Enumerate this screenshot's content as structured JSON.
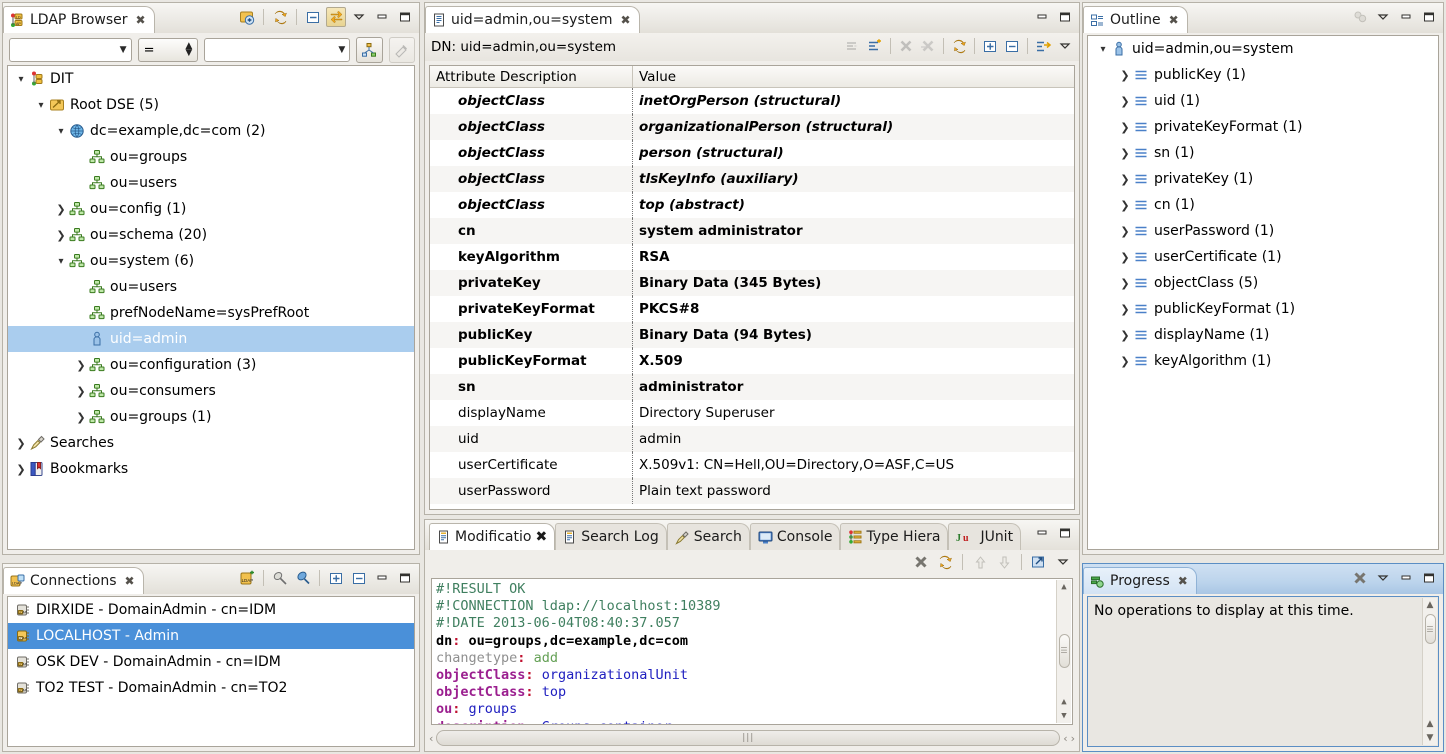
{
  "ldap_browser": {
    "tab_label": "LDAP Browser",
    "tab_close": "✖",
    "toolbar": [
      {
        "name": "open-connection-icon",
        "tip": "Open Connection"
      },
      {
        "name": "refresh-icon",
        "tip": "Refresh"
      },
      {
        "name": "collapse-all-icon",
        "tip": "Collapse All"
      },
      {
        "name": "link-with-editor-icon",
        "tip": "Link with Editor",
        "pressed": true
      },
      {
        "name": "view-menu-icon",
        "tip": "View Menu"
      },
      {
        "name": "minimize-icon",
        "tip": "Minimize"
      },
      {
        "name": "maximize-icon",
        "tip": "Maximize"
      }
    ],
    "filter": {
      "attribute_value": "",
      "attribute_placeholder": "",
      "operator_value": "=",
      "value_value": "",
      "value_placeholder": "",
      "quick_filter_button": "quick-filter-icon",
      "clear_filter_button": "clear-filter-icon"
    },
    "tree": [
      {
        "label": "DIT",
        "indent": 0,
        "twist": "open",
        "icon": "dit-icon",
        "selected": false
      },
      {
        "label": "Root DSE (5)",
        "indent": 1,
        "twist": "open",
        "icon": "rootdse-icon",
        "selected": false
      },
      {
        "label": "dc=example,dc=com (2)",
        "indent": 2,
        "twist": "open",
        "icon": "domain-icon",
        "selected": false
      },
      {
        "label": "ou=groups",
        "indent": 3,
        "twist": "none",
        "icon": "ou-icon",
        "selected": false
      },
      {
        "label": "ou=users",
        "indent": 3,
        "twist": "none",
        "icon": "ou-icon",
        "selected": false
      },
      {
        "label": "ou=config (1)",
        "indent": 2,
        "twist": "closed",
        "icon": "ou-icon",
        "selected": false
      },
      {
        "label": "ou=schema (20)",
        "indent": 2,
        "twist": "closed",
        "icon": "ou-icon",
        "selected": false
      },
      {
        "label": "ou=system (6)",
        "indent": 2,
        "twist": "open",
        "icon": "ou-icon",
        "selected": false
      },
      {
        "label": "ou=users",
        "indent": 3,
        "twist": "none",
        "icon": "ou-icon",
        "selected": false
      },
      {
        "label": "prefNodeName=sysPrefRoot",
        "indent": 3,
        "twist": "none",
        "icon": "ou-icon",
        "selected": false
      },
      {
        "label": "uid=admin",
        "indent": 3,
        "twist": "none",
        "icon": "person-icon",
        "selected": true
      },
      {
        "label": "ou=configuration (3)",
        "indent": 3,
        "twist": "closed",
        "icon": "ou-icon",
        "selected": false
      },
      {
        "label": "ou=consumers",
        "indent": 3,
        "twist": "closed",
        "icon": "ou-icon",
        "selected": false
      },
      {
        "label": "ou=groups (1)",
        "indent": 3,
        "twist": "closed",
        "icon": "ou-icon",
        "selected": false
      },
      {
        "label": "Searches",
        "indent": 0,
        "twist": "closed",
        "icon": "searches-icon",
        "selected": false
      },
      {
        "label": "Bookmarks",
        "indent": 0,
        "twist": "closed",
        "icon": "bookmarks-icon",
        "selected": false
      }
    ]
  },
  "connections": {
    "tab_label": "Connections",
    "tab_close": "✖",
    "toolbar": [
      {
        "name": "new-connection-icon"
      },
      {
        "name": "disconnect-icon"
      },
      {
        "name": "connect-icon"
      },
      {
        "name": "expand-all-icon"
      },
      {
        "name": "collapse-all-icon"
      },
      {
        "name": "minimize-icon"
      },
      {
        "name": "maximize-icon"
      }
    ],
    "items": [
      {
        "label": "DIRXIDE - DomainAdmin - cn=IDM",
        "selected": false
      },
      {
        "label": "LOCALHOST - Admin",
        "selected": true
      },
      {
        "label": "OSK DEV - DomainAdmin - cn=IDM",
        "selected": false
      },
      {
        "label": "TO2 TEST - DomainAdmin - cn=TO2",
        "selected": false
      }
    ]
  },
  "editor": {
    "tab_label": "uid=admin,ou=system",
    "tab_close": "✖",
    "dn_label": "DN: uid=admin,ou=system",
    "toolbar": [
      {
        "name": "new-value-icon",
        "disabled": true
      },
      {
        "name": "new-attribute-icon",
        "disabled": false
      },
      {
        "name": "delete-value-icon",
        "disabled": true
      },
      {
        "name": "delete-attribute-icon",
        "disabled": true
      },
      {
        "name": "refresh-icon",
        "disabled": false
      },
      {
        "name": "expand-all-icon",
        "disabled": false
      },
      {
        "name": "collapse-all-icon",
        "disabled": false
      },
      {
        "name": "sort-icon",
        "disabled": false
      },
      {
        "name": "view-menu-icon",
        "disabled": false
      }
    ],
    "minimize": "minimize-icon",
    "maximize": "maximize-icon",
    "columns": [
      "Attribute Description",
      "Value"
    ],
    "rows": [
      {
        "attr": "objectClass",
        "value": "inetOrgPerson (structural)",
        "style": "bold-italic"
      },
      {
        "attr": "objectClass",
        "value": "organizationalPerson (structural)",
        "style": "bold-italic"
      },
      {
        "attr": "objectClass",
        "value": "person (structural)",
        "style": "bold-italic"
      },
      {
        "attr": "objectClass",
        "value": "tlsKeyInfo (auxiliary)",
        "style": "bold-italic"
      },
      {
        "attr": "objectClass",
        "value": "top (abstract)",
        "style": "bold-italic"
      },
      {
        "attr": "cn",
        "value": "system administrator",
        "style": "bold"
      },
      {
        "attr": "keyAlgorithm",
        "value": "RSA",
        "style": "bold"
      },
      {
        "attr": "privateKey",
        "value": "Binary Data (345 Bytes)",
        "style": "bold"
      },
      {
        "attr": "privateKeyFormat",
        "value": "PKCS#8",
        "style": "bold"
      },
      {
        "attr": "publicKey",
        "value": "Binary Data (94 Bytes)",
        "style": "bold"
      },
      {
        "attr": "publicKeyFormat",
        "value": "X.509",
        "style": "bold"
      },
      {
        "attr": "sn",
        "value": "administrator",
        "style": "bold"
      },
      {
        "attr": "displayName",
        "value": "Directory Superuser",
        "style": "normal"
      },
      {
        "attr": "uid",
        "value": "admin",
        "style": "normal"
      },
      {
        "attr": "userCertificate",
        "value": "X.509v1: CN=Hell,OU=Directory,O=ASF,C=US",
        "style": "normal"
      },
      {
        "attr": "userPassword",
        "value": "Plain text password",
        "style": "normal"
      }
    ]
  },
  "modifications": {
    "tabs": [
      {
        "label": "Modificatio",
        "icon": "modifications-icon",
        "active": true,
        "close": "✖"
      },
      {
        "label": "Search Log",
        "icon": "searchlog-icon",
        "active": false
      },
      {
        "label": "Search",
        "icon": "search-icon",
        "active": false
      },
      {
        "label": "Console",
        "icon": "console-icon",
        "active": false
      },
      {
        "label": "Type Hiera",
        "icon": "type-hierarchy-icon",
        "active": false
      },
      {
        "label": "JUnit",
        "icon": "junit-icon",
        "active": false
      }
    ],
    "minimize": "minimize-icon",
    "maximize": "maximize-icon",
    "toolbar": [
      {
        "name": "clear-icon"
      },
      {
        "name": "refresh-icon"
      },
      {
        "name": "previous-icon"
      },
      {
        "name": "next-icon"
      },
      {
        "name": "export-icon"
      },
      {
        "name": "view-menu-icon"
      }
    ],
    "ldif_lines": [
      {
        "type": "comment",
        "text": "#!RESULT OK"
      },
      {
        "type": "comment",
        "text": "#!CONNECTION ldap://localhost:10389"
      },
      {
        "type": "comment",
        "text": "#!DATE 2013-06-04T08:40:37.057"
      },
      {
        "type": "dn",
        "key": "dn",
        "value": "ou=groups,dc=example,dc=com"
      },
      {
        "type": "changetype",
        "key": "changetype",
        "value": "add"
      },
      {
        "type": "attr",
        "key": "objectClass",
        "value": "organizationalUnit"
      },
      {
        "type": "attr",
        "key": "objectClass",
        "value": "top"
      },
      {
        "type": "attr",
        "key": "ou",
        "value": "groups"
      },
      {
        "type": "attr",
        "key": "description",
        "value": "Groups container"
      }
    ],
    "hscroll_grip": "|||",
    "hscroll_left": "‹",
    "hscroll_prev": "‹",
    "hscroll_next": "›"
  },
  "outline": {
    "tab_label": "Outline",
    "tab_close": "✖",
    "toolbar": [
      {
        "name": "sort-icon"
      },
      {
        "name": "view-menu-icon"
      },
      {
        "name": "minimize-icon"
      },
      {
        "name": "maximize-icon"
      }
    ],
    "items": [
      {
        "label": "uid=admin,ou=system",
        "indent": 0,
        "twist": "open",
        "icon": "person-icon"
      },
      {
        "label": "publicKey (1)",
        "indent": 1,
        "twist": "closed",
        "icon": "attribute-icon"
      },
      {
        "label": "uid (1)",
        "indent": 1,
        "twist": "closed",
        "icon": "attribute-icon"
      },
      {
        "label": "privateKeyFormat (1)",
        "indent": 1,
        "twist": "closed",
        "icon": "attribute-icon"
      },
      {
        "label": "sn (1)",
        "indent": 1,
        "twist": "closed",
        "icon": "attribute-icon"
      },
      {
        "label": "privateKey (1)",
        "indent": 1,
        "twist": "closed",
        "icon": "attribute-icon"
      },
      {
        "label": "cn (1)",
        "indent": 1,
        "twist": "closed",
        "icon": "attribute-icon"
      },
      {
        "label": "userPassword (1)",
        "indent": 1,
        "twist": "closed",
        "icon": "attribute-icon"
      },
      {
        "label": "userCertificate (1)",
        "indent": 1,
        "twist": "closed",
        "icon": "attribute-icon"
      },
      {
        "label": "objectClass (5)",
        "indent": 1,
        "twist": "closed",
        "icon": "attribute-icon"
      },
      {
        "label": "publicKeyFormat (1)",
        "indent": 1,
        "twist": "closed",
        "icon": "attribute-icon"
      },
      {
        "label": "displayName (1)",
        "indent": 1,
        "twist": "closed",
        "icon": "attribute-icon"
      },
      {
        "label": "keyAlgorithm (1)",
        "indent": 1,
        "twist": "closed",
        "icon": "attribute-icon"
      }
    ]
  },
  "progress": {
    "tab_label": "Progress",
    "tab_close": "✖",
    "toolbar": [
      {
        "name": "clear-icon"
      },
      {
        "name": "view-menu-icon"
      },
      {
        "name": "minimize-icon"
      },
      {
        "name": "maximize-icon"
      }
    ],
    "message": "No operations to display at this time.",
    "scroll_up": "▲",
    "scroll_down": "▼"
  },
  "colors": {
    "selection_tree": "#aacdee",
    "selection_list": "#4a90d9",
    "progress_accent": "#5b8ec4",
    "ldif_comment": "#3f7f5f",
    "ldif_attr": "#9b1f8f",
    "ldif_value": "#2020c0",
    "ldif_colon": "#c01030",
    "ldif_changetype": "#8f8f8f",
    "ldif_changevalue": "#64a055"
  }
}
